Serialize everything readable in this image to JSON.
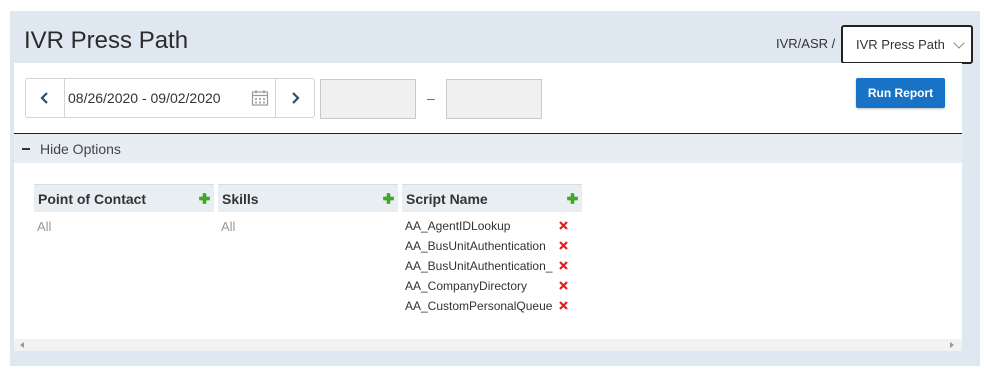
{
  "header": {
    "title": "IVR Press Path",
    "breadcrumb": "IVR/ASR /",
    "report_select": "IVR Press Path"
  },
  "filters": {
    "date_range": "08/26/2020 - 09/02/2020",
    "time_separator": "–",
    "run_report_label": "Run Report"
  },
  "options": {
    "toggle_label": "Hide Options"
  },
  "columns": {
    "point_of_contact": {
      "header": "Point of Contact",
      "value": "All"
    },
    "skills": {
      "header": "Skills",
      "value": "All"
    },
    "script_name": {
      "header": "Script Name",
      "items": [
        "AA_AgentIDLookup",
        "AA_BusUnitAuthentication",
        "AA_BusUnitAuthentication_",
        "AA_CompanyDirectory",
        "AA_CustomPersonalQueue"
      ]
    }
  },
  "colors": {
    "accent": "#1873c6",
    "plus": "#3cb521",
    "remove": "#e02020",
    "background": "#dfe7f0"
  }
}
